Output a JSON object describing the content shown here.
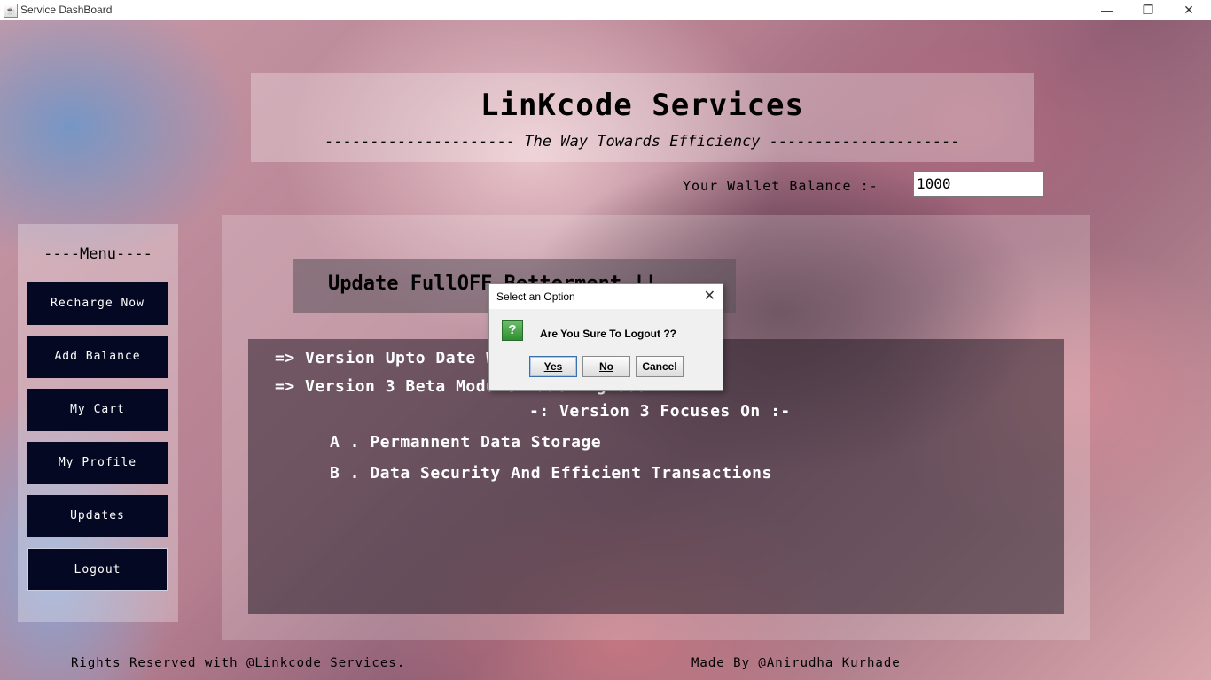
{
  "window": {
    "title": "Service DashBoard",
    "controls": {
      "minimize": "—",
      "restore": "❐",
      "close": "✕"
    }
  },
  "header": {
    "title": "LinKcode Services",
    "subtitle": "--------------------- The Way Towards Efficiency ---------------------"
  },
  "wallet": {
    "label": "Your Wallet Balance :-",
    "value": "1000"
  },
  "menu": {
    "title": "----Menu----",
    "items": [
      {
        "label": "Recharge Now"
      },
      {
        "label": "Add Balance"
      },
      {
        "label": "My Cart"
      },
      {
        "label": "My Profile"
      },
      {
        "label": "Updates"
      },
      {
        "label": "Logout"
      }
    ]
  },
  "update_banner": "Update FullOFF Betterment !!",
  "content": {
    "line1": "=> Version Upto Date With Backend Module 2.8",
    "line2": "=> Version 3 Beta Module Lauching Soon",
    "line3": "-: Version 3 Focuses On :-",
    "line4": "A . Permannent Data Storage",
    "line5": "B . Data Security And Efficient Transactions"
  },
  "footer": {
    "left": "Rights Reserved with @Linkcode Services.",
    "right": "Made By @Anirudha Kurhade"
  },
  "dialog": {
    "title": "Select an Option",
    "message": "Are You Sure To Logout ??",
    "icon": "question-icon",
    "buttons": {
      "yes": "Yes",
      "no": "No",
      "cancel": "Cancel"
    }
  },
  "colors": {
    "menu_button": "#040822",
    "dialog_bg": "#f0f0f0"
  }
}
